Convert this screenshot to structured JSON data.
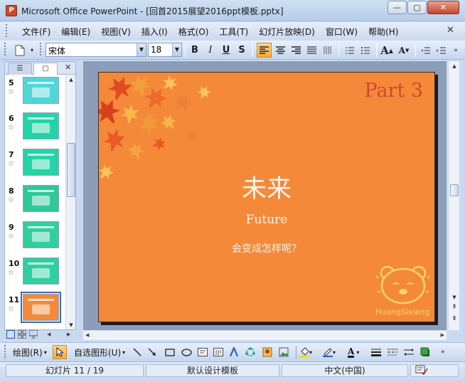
{
  "window": {
    "title": "Microsoft Office PowerPoint - [回首2015展望2016ppt模板.pptx]",
    "app_icon": "P",
    "minimize_icon": "—",
    "maximize_icon": "▢",
    "close_icon": "✕"
  },
  "menu": {
    "items": [
      "文件(F)",
      "编辑(E)",
      "视图(V)",
      "插入(I)",
      "格式(O)",
      "工具(T)",
      "幻灯片放映(D)",
      "窗口(W)",
      "帮助(H)"
    ],
    "close_icon": "✕"
  },
  "toolbar": {
    "font_name": "宋体",
    "font_size": "18",
    "bold": "B",
    "italic": "I",
    "underline": "U",
    "shadow": "S",
    "grow_font": "A",
    "shrink_font": "A"
  },
  "left_pane": {
    "tab_outline_icon": "☰",
    "tab_slides_icon": "▢",
    "close_icon": "✕",
    "thumbnails": [
      {
        "num": "5",
        "color": "#4fd6d8"
      },
      {
        "num": "6",
        "color": "#24d3a6"
      },
      {
        "num": "7",
        "color": "#24d3a6"
      },
      {
        "num": "8",
        "color": "#2fc89a"
      },
      {
        "num": "9",
        "color": "#2fcf9f"
      },
      {
        "num": "10",
        "color": "#2fcf9f"
      },
      {
        "num": "11",
        "color": "#f4893a"
      }
    ],
    "star_icon": "☆"
  },
  "slide": {
    "part": "Part 3",
    "title": "未来",
    "subtitle": "Future",
    "caption": "会变成怎样呢？",
    "bear_name": "HuangSixiang",
    "background": "#f4893a"
  },
  "drawbar": {
    "draw": "绘图(R)",
    "autoshapes": "自选图形(U)"
  },
  "status": {
    "slide_info": "幻灯片 11 / 19",
    "design": "默认设计模板",
    "language": "中文(中国)"
  }
}
